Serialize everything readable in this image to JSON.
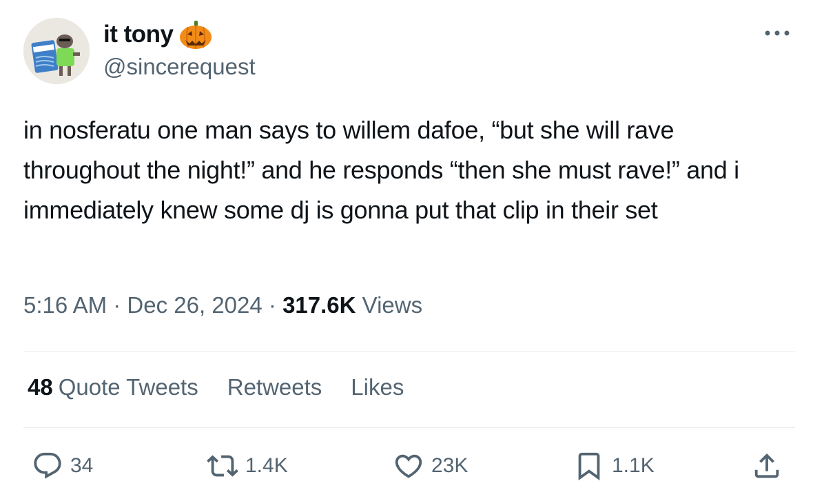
{
  "author": {
    "display_name": "it tony",
    "handle": "@sincerequest",
    "avatar_icon": "avatar-image",
    "name_emoji": "🎃"
  },
  "header": {
    "more_icon": "more-horizontal-icon"
  },
  "tweet": {
    "text": "in nosferatu one man says to willem dafoe, “but she will rave throughout the night!” and he responds “then she must rave!” and i immediately knew some dj is gonna put that clip in their set"
  },
  "meta": {
    "time": "5:16 AM",
    "separator": "·",
    "date": "Dec 26, 2024",
    "views_count": "317.6K",
    "views_label": "Views"
  },
  "stats": {
    "quote_count": "48",
    "quote_label": "Quote Tweets",
    "retweets_label": "Retweets",
    "likes_label": "Likes"
  },
  "actions": {
    "reply_count": "34",
    "retweet_count": "1.4K",
    "like_count": "23K",
    "bookmark_count": "1.1K",
    "icons": [
      "reply-icon",
      "retweet-icon",
      "like-icon",
      "bookmark-icon",
      "share-icon"
    ]
  },
  "colors": {
    "text_primary": "#0f1419",
    "text_secondary": "#536471",
    "divider": "#e7e9ea",
    "pumpkin": "#f28c18"
  }
}
